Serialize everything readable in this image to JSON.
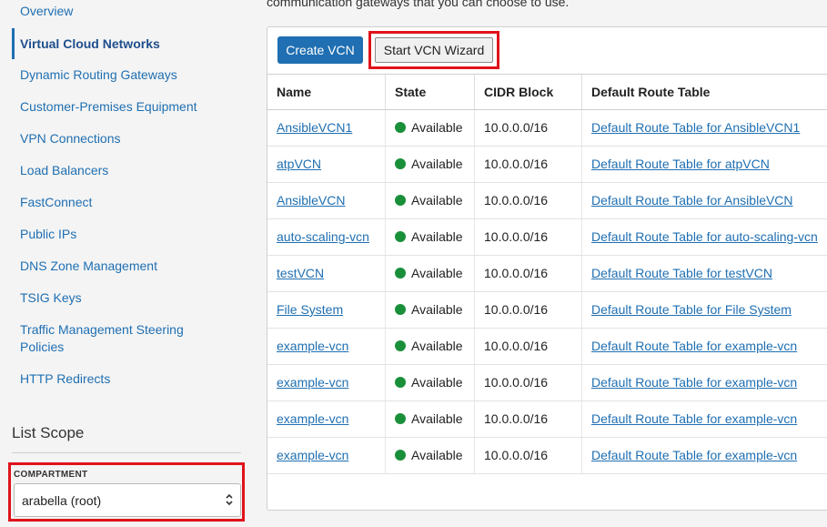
{
  "sidebar": {
    "items": [
      {
        "label": "Overview",
        "active": false
      },
      {
        "label": "Virtual Cloud Networks",
        "active": true
      },
      {
        "label": "Dynamic Routing Gateways",
        "active": false
      },
      {
        "label": "Customer-Premises Equipment",
        "active": false
      },
      {
        "label": "VPN Connections",
        "active": false
      },
      {
        "label": "Load Balancers",
        "active": false
      },
      {
        "label": "FastConnect",
        "active": false
      },
      {
        "label": "Public IPs",
        "active": false
      },
      {
        "label": "DNS Zone Management",
        "active": false
      },
      {
        "label": "TSIG Keys",
        "active": false
      },
      {
        "label": "Traffic Management Steering Policies",
        "active": false
      },
      {
        "label": "HTTP Redirects",
        "active": false
      }
    ],
    "list_scope": {
      "title": "List Scope",
      "compartment_label": "COMPARTMENT",
      "compartment_value": "arabella (root)"
    }
  },
  "main": {
    "intro_text": "communication gateways that you can choose to use.",
    "toolbar": {
      "create_label": "Create VCN",
      "wizard_label": "Start VCN Wizard"
    },
    "table": {
      "columns": [
        "Name",
        "State",
        "CIDR Block",
        "Default Route Table"
      ],
      "rows": [
        {
          "name": "AnsibleVCN1",
          "state": "Available",
          "cidr": "10.0.0.0/16",
          "route": "Default Route Table for AnsibleVCN1"
        },
        {
          "name": "atpVCN",
          "state": "Available",
          "cidr": "10.0.0.0/16",
          "route": "Default Route Table for atpVCN"
        },
        {
          "name": "AnsibleVCN",
          "state": "Available",
          "cidr": "10.0.0.0/16",
          "route": "Default Route Table for AnsibleVCN"
        },
        {
          "name": "auto-scaling-vcn",
          "state": "Available",
          "cidr": "10.0.0.0/16",
          "route": "Default Route Table for auto-scaling-vcn"
        },
        {
          "name": "testVCN",
          "state": "Available",
          "cidr": "10.0.0.0/16",
          "route": "Default Route Table for testVCN"
        },
        {
          "name": "File System",
          "state": "Available",
          "cidr": "10.0.0.0/16",
          "route": "Default Route Table for File System"
        },
        {
          "name": "example-vcn",
          "state": "Available",
          "cidr": "10.0.0.0/16",
          "route": "Default Route Table for example-vcn"
        },
        {
          "name": "example-vcn",
          "state": "Available",
          "cidr": "10.0.0.0/16",
          "route": "Default Route Table for example-vcn"
        },
        {
          "name": "example-vcn",
          "state": "Available",
          "cidr": "10.0.0.0/16",
          "route": "Default Route Table for example-vcn"
        },
        {
          "name": "example-vcn",
          "state": "Available",
          "cidr": "10.0.0.0/16",
          "route": "Default Route Table for example-vcn"
        }
      ]
    }
  },
  "colors": {
    "accent": "#1f6fb2",
    "highlight": "#e0131b",
    "status_available": "#1a8f3a"
  },
  "icons": {
    "status": "status-dot-icon",
    "select": "chevron-up-down-icon"
  }
}
